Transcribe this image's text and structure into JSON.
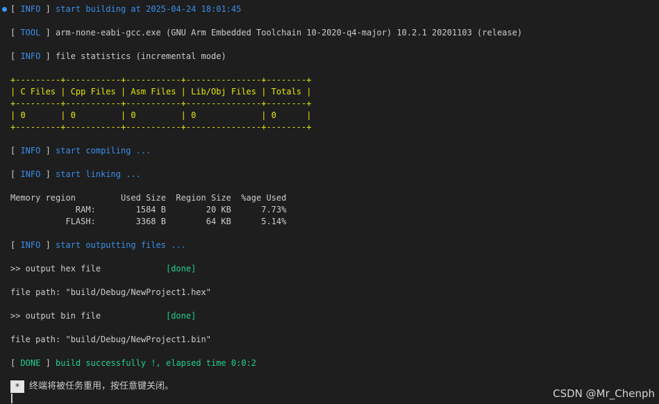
{
  "colors": {
    "background": "#1e1e1e",
    "info": "#3b8eea",
    "done": "#23d18b",
    "table_border": "#e5e510",
    "text": "#cccccc"
  },
  "lines": {
    "l1": {
      "tag": "INFO",
      "msg": "start building at 2025-04-24 18:01:45"
    },
    "l2": {
      "tag": "TOOL",
      "msg": "arm-none-eabi-gcc.exe (GNU Arm Embedded Toolchain 10-2020-q4-major) 10.2.1 20201103 (release)"
    },
    "l3": {
      "tag": "INFO",
      "msg": "file statistics (incremental mode)"
    },
    "l4": {
      "tag": "INFO",
      "msg": "start compiling ..."
    },
    "l5": {
      "tag": "INFO",
      "msg": "start linking ..."
    },
    "l6": {
      "tag": "INFO",
      "msg": "start outputting files ..."
    },
    "l7": {
      "tag": "DONE",
      "msg": "build successfully !, elapsed time 0:0:2"
    }
  },
  "table": {
    "border": "+---------+-----------+-----------+---------------+--------+",
    "header": "| C Files | Cpp Files | Asm Files | Lib/Obj Files | Totals |",
    "row": "| 0       | 0         | 0         | 0             | 0      |"
  },
  "memory": {
    "header": "Memory region         Used Size  Region Size  %age Used",
    "ram": "             RAM:        1584 B        20 KB      7.73%",
    "flash": "           FLASH:        3368 B        64 KB      5.14%"
  },
  "output": {
    "hex_line": ">> output hex file",
    "hex_status": "[done]",
    "hex_path": "file path: \"build/Debug/NewProject1.hex\"",
    "bin_line": ">> output bin file",
    "bin_status": "[done]",
    "bin_path": "file path: \"build/Debug/NewProject1.bin\""
  },
  "footer": {
    "box_symbol": "*",
    "text": "终端将被任务重用，按任意键关闭。"
  },
  "watermark": "CSDN @Mr_Chenph"
}
